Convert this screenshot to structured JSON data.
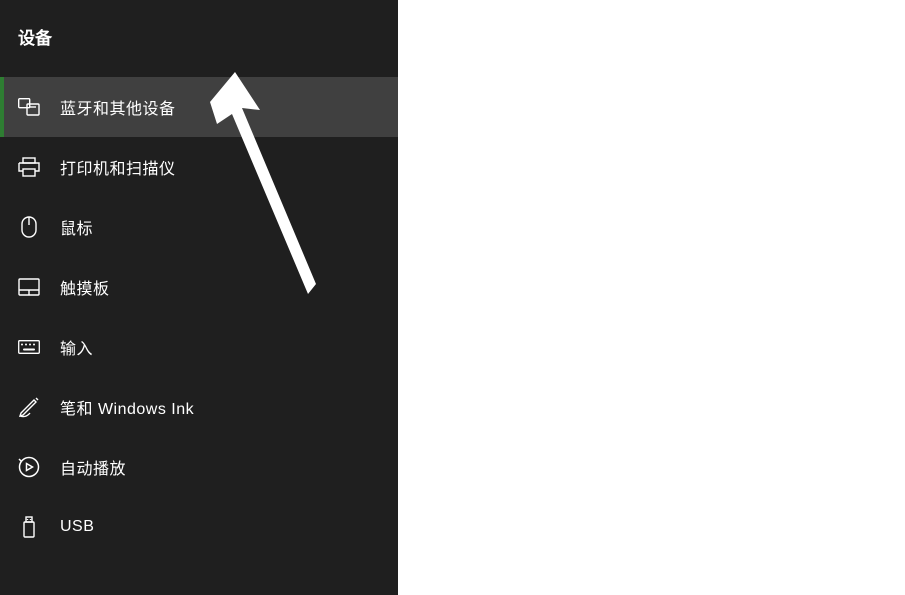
{
  "sidebar": {
    "title": "设备",
    "items": [
      {
        "id": "bluetooth",
        "label": "蓝牙和其他设备",
        "selected": true
      },
      {
        "id": "printers",
        "label": "打印机和扫描仪",
        "selected": false
      },
      {
        "id": "mouse",
        "label": "鼠标",
        "selected": false
      },
      {
        "id": "touchpad",
        "label": "触摸板",
        "selected": false
      },
      {
        "id": "typing",
        "label": "输入",
        "selected": false
      },
      {
        "id": "pen",
        "label": "笔和 Windows Ink",
        "selected": false
      },
      {
        "id": "autoplay",
        "label": "自动播放",
        "selected": false
      },
      {
        "id": "usb",
        "label": "USB",
        "selected": false
      }
    ]
  }
}
